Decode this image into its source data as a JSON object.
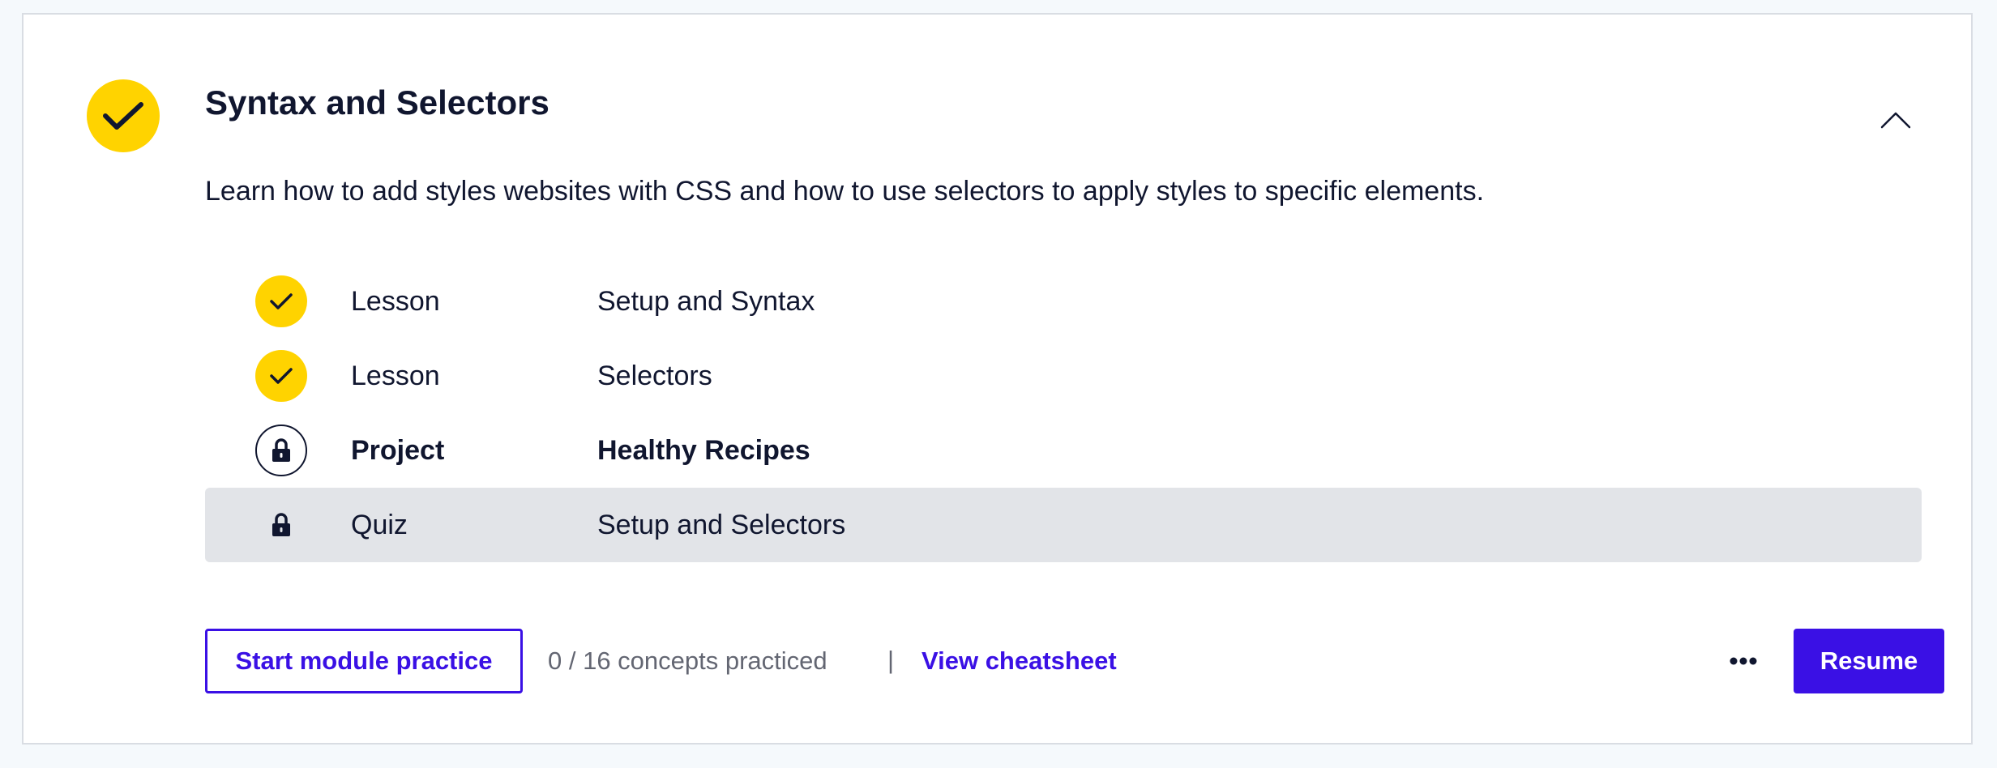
{
  "module": {
    "title": "Syntax and Selectors",
    "description": "Learn how to add styles websites with CSS and how to use selectors to apply styles to specific elements.",
    "status_icon": "check-icon",
    "collapse_icon": "chevron-up-icon",
    "items": [
      {
        "type": "Lesson",
        "name": "Setup and Syntax",
        "status": "complete",
        "icon": "check-icon"
      },
      {
        "type": "Lesson",
        "name": "Selectors",
        "status": "complete",
        "icon": "check-icon"
      },
      {
        "type": "Project",
        "name": "Healthy Recipes",
        "status": "locked",
        "icon": "lock-icon"
      },
      {
        "type": "Quiz",
        "name": "Setup and Selectors",
        "status": "locked",
        "icon": "lock-icon"
      }
    ]
  },
  "footer": {
    "practice_label": "Start module practice",
    "concepts_text": "0 / 16 concepts practiced",
    "divider": "|",
    "cheatsheet_label": "View cheatsheet",
    "more_icon": "more-horizontal-icon",
    "resume_label": "Resume"
  },
  "colors": {
    "accent": "#3a10e5",
    "complete": "#ffd300",
    "text": "#10162f",
    "muted": "#636672",
    "highlight_row": "#e2e4e8"
  }
}
